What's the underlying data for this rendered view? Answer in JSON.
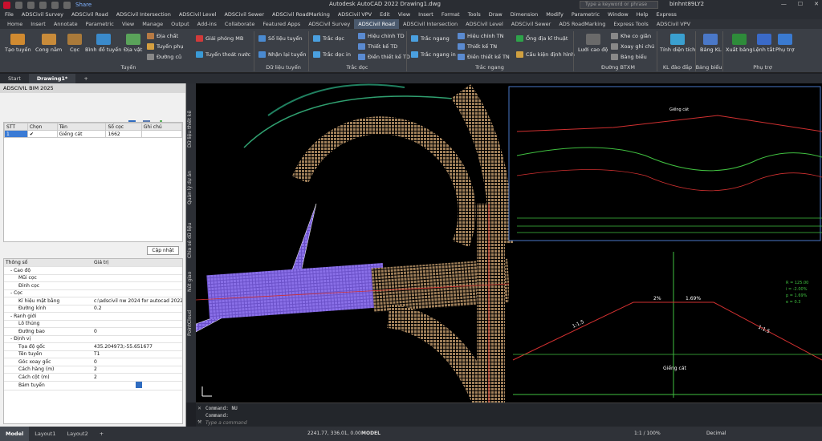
{
  "app": {
    "title": "Autodesk AutoCAD 2022   Drawing1.dwg",
    "share": "Share",
    "search_placeholder": "Type a keyword or phrase",
    "user": "binhnt89LY2"
  },
  "menu": [
    "File",
    "Edit",
    "View",
    "Insert",
    "Format",
    "Tools",
    "Draw",
    "Dimension",
    "Modify",
    "Parametric",
    "Window",
    "Help",
    "Express"
  ],
  "menu_left": [
    "ADSCivil Survey",
    "ADSCivil Road",
    "ADSCivil Intersection",
    "ADSCivil Level",
    "ADSCivil Sewer",
    "ADSCivil RoadMarking",
    "ADSCivil VPV"
  ],
  "tabs": [
    "Home",
    "Insert",
    "Annotate",
    "Parametric",
    "View",
    "Manage",
    "Output",
    "Add-ins",
    "Collaborate",
    "Featured Apps",
    "ADSCivil Survey",
    "ADSCivil Road",
    "ADSCivil Intersection",
    "ADSCivil Level",
    "ADSCivil Sewer",
    "ADS RoadMarking",
    "Express Tools",
    "ADSCivil VPV"
  ],
  "active_tab": "ADSCivil Road",
  "ribbon": {
    "tao_tuyen": "Tạo tuyến",
    "cong_nam": "Cong nằm",
    "coc": "Cọc",
    "binh_do_tuyen": "Bình đồ tuyến",
    "dia_vat": "Địa vật",
    "dia_chat": "Địa chất",
    "tuyen_phu": "Tuyến phụ",
    "duong_cu": "Đường cũ",
    "giai_phong_mb": "Giải phóng MB",
    "tuyen_thoat_nuoc": "Tuyến thoát nước",
    "group_tuyen": "Tuyến",
    "so_lieu_tuyen": "Số liệu tuyến",
    "nhan_lai_tuyen": "Nhận lại tuyến",
    "group_du_lieu": "Dữ liệu tuyến",
    "trac_doc": "Trắc dọc",
    "trac_doc_in": "Trắc dọc in",
    "hieu_chinh_td": "Hiệu chỉnh TD",
    "thiet_ke_td": "Thiết kế TD",
    "dien_thiet_ke_td": "Điền thiết kế TD",
    "group_trac_doc": "Trắc dọc",
    "trac_ngang": "Trắc ngang",
    "trac_ngang_in": "Trắc ngang in",
    "hieu_chinh_tn": "Hiệu chỉnh TN",
    "thiet_ke_tn": "Thiết kế TN",
    "dien_thiet_ke_tn": "Điền thiết kế TN",
    "ong_dia_ki_thuat": "Ống địa kĩ thuật",
    "cau_kien_dinh_hinh": "Cấu kiện định hình",
    "group_trac_ngang": "Trắc ngang",
    "luoi_cao_do": "Lưới cao độ",
    "khe_co_gian": "Khe co giãn",
    "xoay_ghi_chu": "Xoay ghi chú",
    "bang_bieu": "Bảng biểu",
    "group_duong_btxm": "Đường BTXM",
    "tinh_dien_tich": "Tính diện tích",
    "group_kl": "KL đào đắp",
    "bang_kl": "Bảng KL",
    "group_bang_bieu": "Bảng biểu",
    "xuat_bang": "Xuất bảng",
    "lenh_tat": "Lệnh tắt",
    "phu_tro": "Phụ trợ",
    "group_phu_tro": "Phụ trợ"
  },
  "doc_tabs": [
    "Start",
    "Drawing1*"
  ],
  "palette": {
    "title": "ADSCIVIL BIM 2025",
    "headers": [
      "STT",
      "Chọn",
      "Tên",
      "Số cọc",
      "Ghi chú"
    ],
    "rows": [
      {
        "stt": "1",
        "ten": "Giếng cát",
        "so_coc": "1662",
        "ghi_chu": ""
      }
    ],
    "update_button": "Cập nhật",
    "prop_headers": [
      "Thông số",
      "Giá trị"
    ],
    "props": [
      {
        "name": "- Cao độ",
        "value": ""
      },
      {
        "name": "Mũi cọc",
        "value": ""
      },
      {
        "name": "Đỉnh cọc",
        "value": ""
      },
      {
        "name": "- Cọc",
        "value": ""
      },
      {
        "name": "Kí hiệu mặt bằng",
        "value": "c:\\adscivil nw 2024 for autocad 2022\\..."
      },
      {
        "name": "Đường kính",
        "value": "0.2"
      },
      {
        "name": "- Ranh giới",
        "value": ""
      },
      {
        "name": "Lỗ thủng",
        "value": ""
      },
      {
        "name": "Đường bao",
        "value": "0"
      },
      {
        "name": "- Định vị",
        "value": ""
      },
      {
        "name": "Tọa độ gốc",
        "value": "435.204973;-55.651677"
      },
      {
        "name": "Tên tuyến",
        "value": "T1"
      },
      {
        "name": "Góc xoay gốc",
        "value": "0"
      },
      {
        "name": "Cách hàng (m)",
        "value": "2"
      },
      {
        "name": "Cách cột (m)",
        "value": "2"
      },
      {
        "name": "Bám tuyến",
        "value": ""
      }
    ]
  },
  "side_tabs": [
    "Dữ liệu thiết kế",
    "Quản lý dự án",
    "Chia sẻ dữ liệu",
    "Nút giao",
    "PointCloud"
  ],
  "canvas": {
    "profile_label": "Giếng cát",
    "section_label": "Giếng cát",
    "slope_left": "1:1.5",
    "slope_right": "1:1.5",
    "grade_left": "2%",
    "grade_right": "1.69%",
    "curve_info": [
      "R = 125.00",
      "i = -2.00%",
      "p = 1.69%",
      "e = 0.3"
    ]
  },
  "command": {
    "lines": [
      "Command: NU",
      "Command:"
    ],
    "placeholder": "Type a command"
  },
  "status": {
    "tabs": [
      "Model",
      "Layout1",
      "Layout2"
    ],
    "coords": "2241.77, 336.01, 0.00",
    "model": "MODEL",
    "zoom": "1:1 / 100%",
    "units": "Decimal"
  }
}
